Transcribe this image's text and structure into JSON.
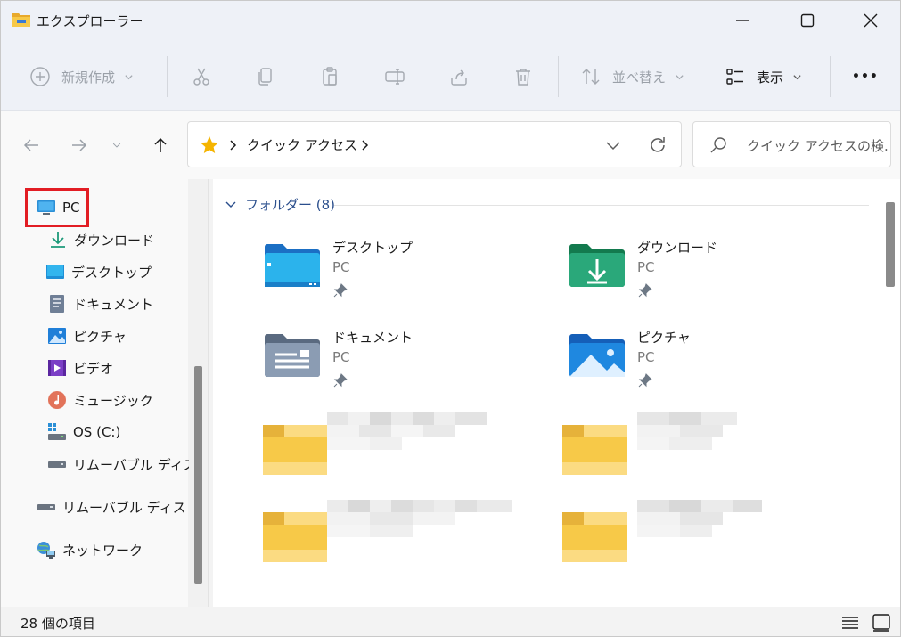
{
  "window": {
    "title": "エクスプローラー"
  },
  "command_bar": {
    "new_label": "新規作成",
    "sort_label": "並べ替え",
    "view_label": "表示",
    "more_label": "•••"
  },
  "address": {
    "crumbs": [
      "クイック アクセス"
    ],
    "search_placeholder": "クイック アクセスの検..."
  },
  "nav_pane": {
    "items": [
      {
        "label": "PC",
        "icon": "monitor-icon"
      },
      {
        "label": "ダウンロード",
        "icon": "download-icon"
      },
      {
        "label": "デスクトップ",
        "icon": "desktop-icon"
      },
      {
        "label": "ドキュメント",
        "icon": "document-icon"
      },
      {
        "label": "ピクチャ",
        "icon": "picture-icon"
      },
      {
        "label": "ビデオ",
        "icon": "video-icon"
      },
      {
        "label": "ミュージック",
        "icon": "music-icon"
      },
      {
        "label": "OS (C:)",
        "icon": "drive-icon"
      },
      {
        "label": "リムーバブル ディスク",
        "icon": "removable-drive-icon"
      },
      {
        "label": "リムーバブル ディスク",
        "icon": "removable-drive-icon"
      },
      {
        "label": "ネットワーク",
        "icon": "network-icon"
      }
    ],
    "highlighted": "PC"
  },
  "content": {
    "group_header": "フォルダー (8)",
    "folders": [
      {
        "name": "デスクトップ",
        "location": "PC",
        "icon": "desktop-folder-icon",
        "pinned": true
      },
      {
        "name": "ダウンロード",
        "location": "PC",
        "icon": "download-folder-icon",
        "pinned": true
      },
      {
        "name": "ドキュメント",
        "location": "PC",
        "icon": "documents-folder-icon",
        "pinned": true
      },
      {
        "name": "ピクチャ",
        "location": "PC",
        "icon": "pictures-folder-icon",
        "pinned": true
      }
    ]
  },
  "status_bar": {
    "item_count": "28 個の項目"
  },
  "colors": {
    "highlight_border": "#e21d24",
    "group_header": "#2a4e8c",
    "folder_yellow": "#f7c948"
  }
}
